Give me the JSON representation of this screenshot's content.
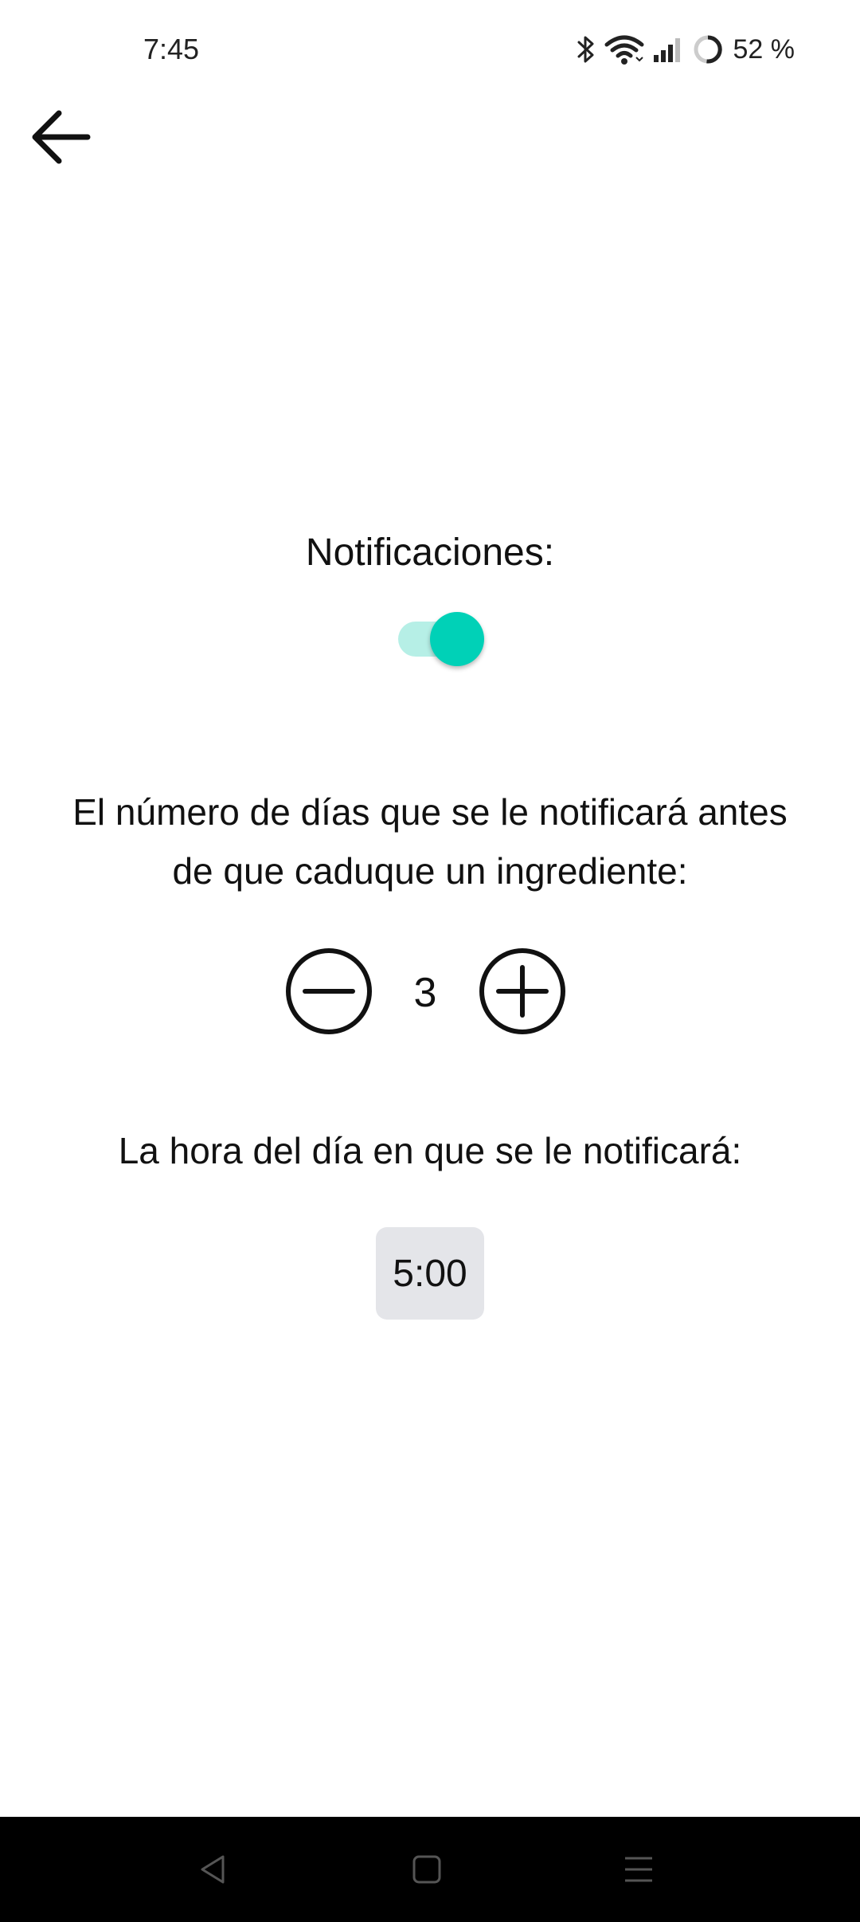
{
  "status_bar": {
    "time": "7:45",
    "battery_text": "52 %",
    "icons": [
      "bluetooth-icon",
      "wifi-icon",
      "signal-icon",
      "battery-ring-icon"
    ]
  },
  "header": {
    "back_icon": "arrow-left-icon"
  },
  "notifications": {
    "title": "Notificaciones:",
    "enabled": true,
    "toggle_track_color": "#b6efe6",
    "toggle_thumb_color": "#00d1b7"
  },
  "days": {
    "description": "El número de días que se le notificará antes de que caduque un ingrediente:",
    "value": "3",
    "decrement_icon": "minus-circle-icon",
    "increment_icon": "plus-circle-icon"
  },
  "time": {
    "description": "La hora del día en que se le notificará:",
    "value": "5:00",
    "button_color": "#e4e5e9"
  },
  "nav_bar": {
    "buttons": [
      "back-triangle-icon",
      "home-square-icon",
      "menu-lines-icon"
    ]
  }
}
